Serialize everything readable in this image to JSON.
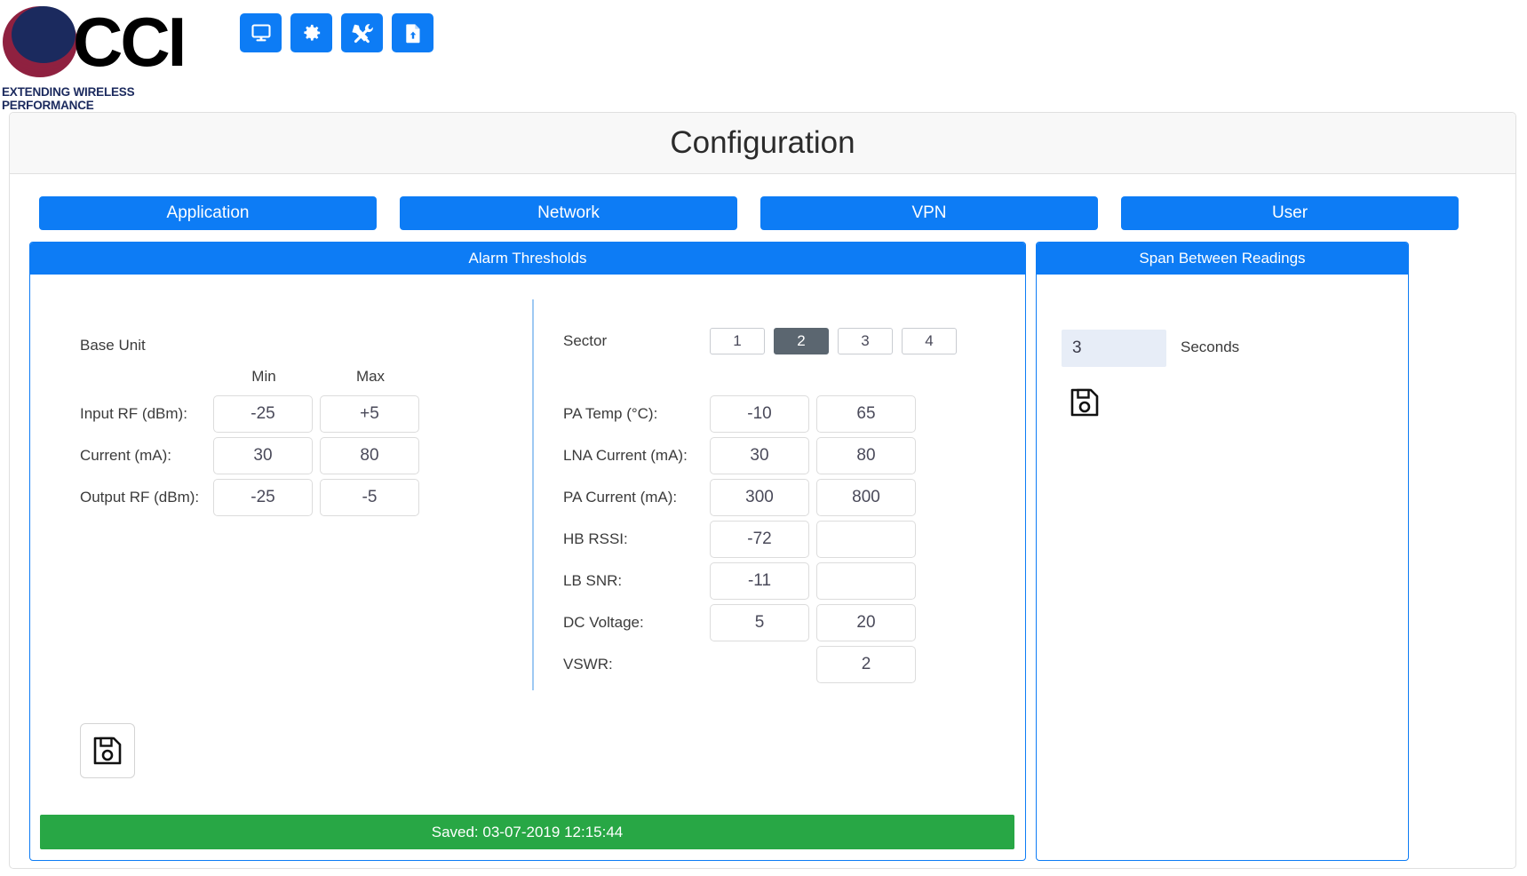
{
  "brand": {
    "name": "CCI",
    "tagline": "EXTENDING WIRELESS PERFORMANCE"
  },
  "toolbar": {
    "buttons": [
      {
        "name": "monitor-icon",
        "label": "Monitor"
      },
      {
        "name": "gear-icon",
        "label": "Settings"
      },
      {
        "name": "tools-icon",
        "label": "Tools"
      },
      {
        "name": "file-upload-icon",
        "label": "Upload"
      }
    ]
  },
  "header": {
    "title": "Configuration"
  },
  "tabs": [
    {
      "label": "Application"
    },
    {
      "label": "Network"
    },
    {
      "label": "VPN"
    },
    {
      "label": "User"
    }
  ],
  "alarm_panel": {
    "title": "Alarm Thresholds",
    "base_unit_label": "Base Unit",
    "col_min": "Min",
    "col_max": "Max",
    "base_rows": [
      {
        "label": "Input RF (dBm):",
        "min": "-25",
        "max": "+5"
      },
      {
        "label": "Current (mA):",
        "min": "30",
        "max": "80"
      },
      {
        "label": "Output RF (dBm):",
        "min": "-25",
        "max": "-5"
      }
    ],
    "sector": {
      "label": "Sector",
      "options": [
        "1",
        "2",
        "3",
        "4"
      ],
      "selected": "2"
    },
    "sector_rows": [
      {
        "label": "PA Temp (°C):",
        "min": "-10",
        "max": "65"
      },
      {
        "label": "LNA Current (mA):",
        "min": "30",
        "max": "80"
      },
      {
        "label": "PA Current (mA):",
        "min": "300",
        "max": "800"
      },
      {
        "label": "HB RSSI:",
        "min": "-72",
        "max": ""
      },
      {
        "label": "LB SNR:",
        "min": "-11",
        "max": ""
      },
      {
        "label": "DC Voltage:",
        "min": "5",
        "max": "20"
      },
      {
        "label": "VSWR:",
        "min": null,
        "max": "2"
      }
    ],
    "save_icon": "floppy-disk-icon",
    "status": "Saved: 03-07-2019 12:15:44"
  },
  "span_panel": {
    "title": "Span Between Readings",
    "value": "3",
    "unit": "Seconds",
    "save_icon": "floppy-disk-icon"
  },
  "colors": {
    "accent": "#0d7cf5",
    "success": "#28a745",
    "selected_sector": "#5b6670",
    "logo_navy": "#1b2a5e",
    "logo_maroon": "#8f2140"
  }
}
